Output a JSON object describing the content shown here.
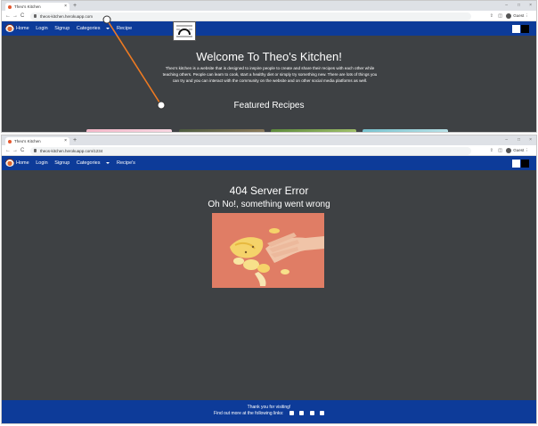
{
  "top_window": {
    "tab_title": "Theo's Kitchen",
    "url": "theos-kitchen.herokuapp.com",
    "profile_label": "Guest"
  },
  "bottom_window": {
    "tab_title": "Theo's Kitchen",
    "url": "theos-kitchen.herokuapp.com/1234",
    "profile_label": "Guest"
  },
  "nav": {
    "home": "Home",
    "login": "Login",
    "signup": "Signup",
    "categories": "Categories",
    "recipes": "Recipe's"
  },
  "nav_top": {
    "recipes_partial": "Recipe"
  },
  "hero": {
    "title": "Welcome To Theo's Kitchen!",
    "text": "Theo's kitchen is a website that is designed to inspire people to create and share their recipes with each other while teaching others. People can learn to cook, start a healthy diet or simply try something new. There are lots of things you can try and you can interact with the community on the website and on other social media platforms as well.",
    "featured_heading": "Featured Recipes"
  },
  "error_page": {
    "title": "404 Server Error",
    "subtitle": "Oh No!, something went wrong"
  },
  "footer": {
    "line1": "Thank you for visiting!",
    "line2": "Find out more at the following links:",
    "social_icons": [
      "facebook-icon",
      "twitter-icon",
      "instagram-icon",
      "youtube-icon"
    ]
  },
  "browser_controls": {
    "new_tab": "+",
    "close": "×",
    "minimize": "–",
    "maximize": "□",
    "back": "←",
    "forward": "→",
    "reload": "C"
  },
  "colors": {
    "navbar": "#0d3b99",
    "page_bg": "#3e4144",
    "annotation": "#ee7a22"
  }
}
